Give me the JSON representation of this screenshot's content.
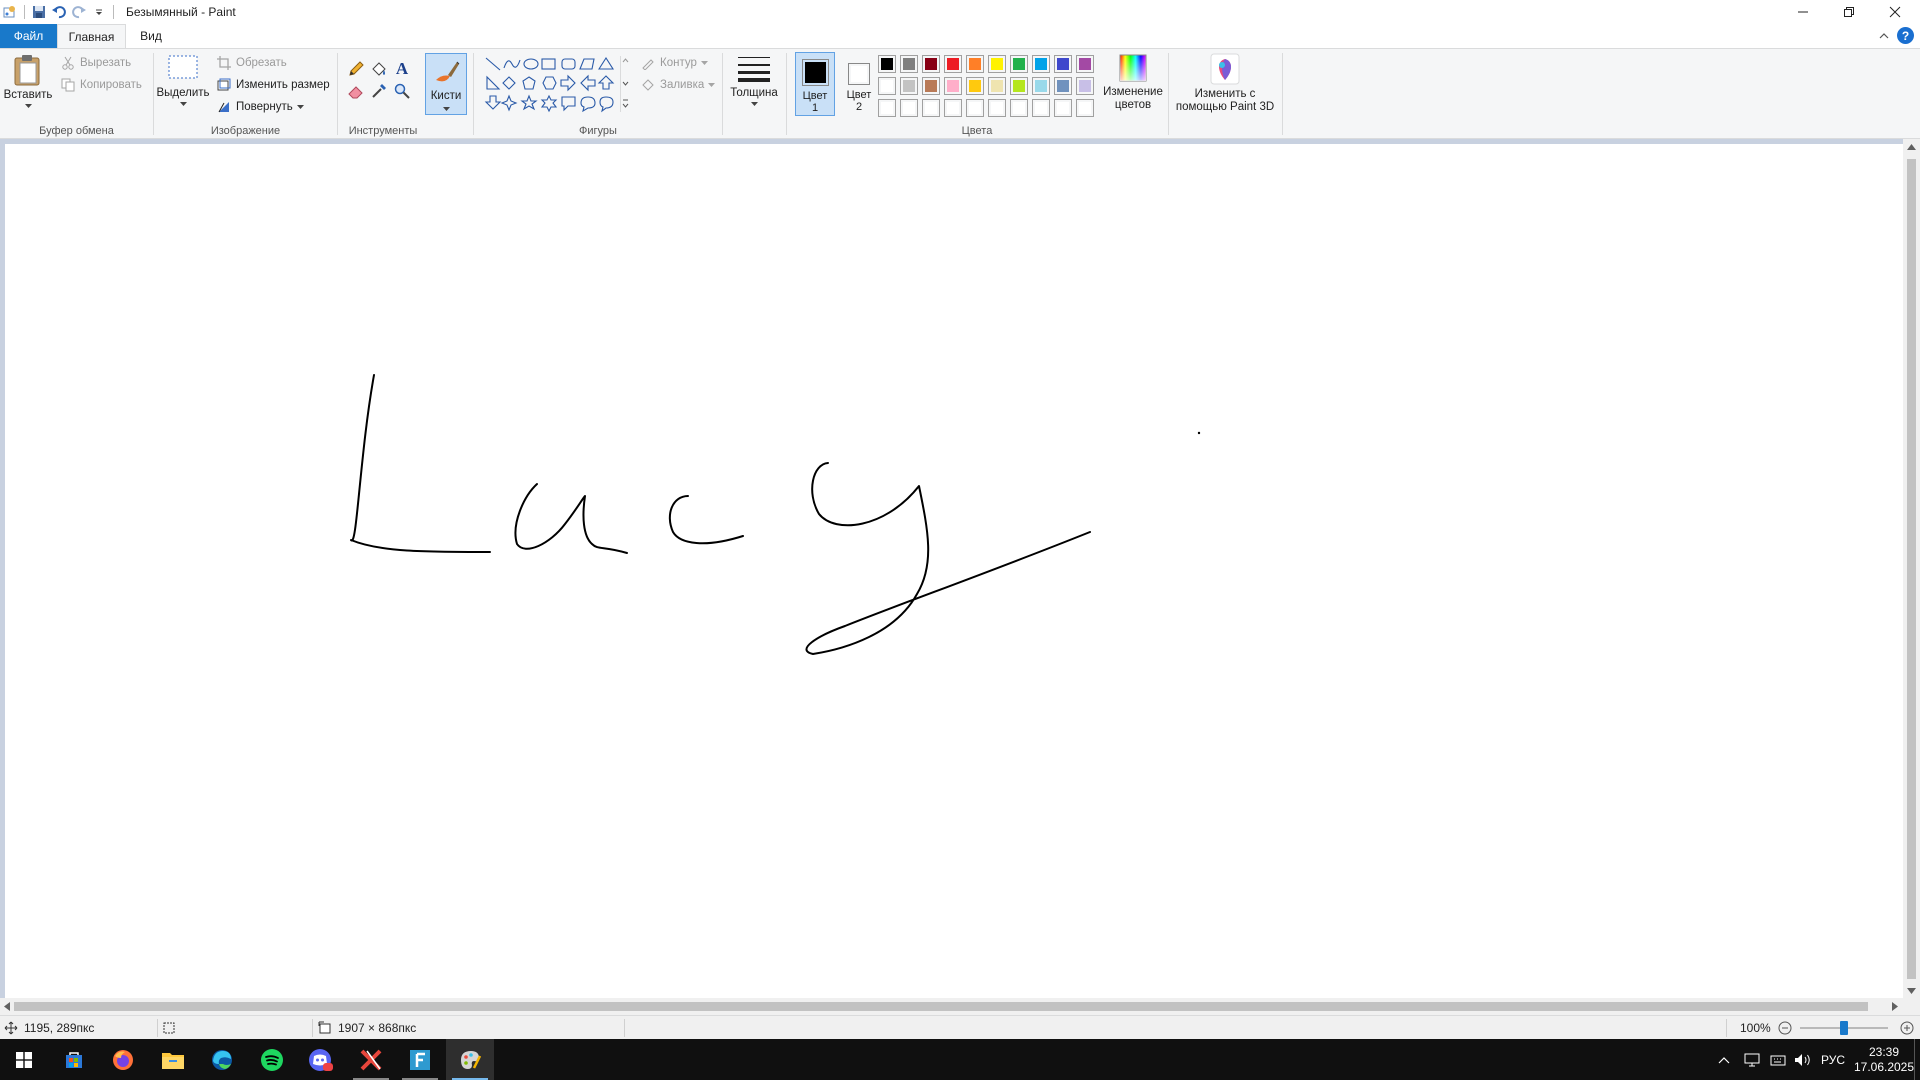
{
  "window": {
    "title": "Безымянный - Paint"
  },
  "tabs": {
    "file": "Файл",
    "home": "Главная",
    "view": "Вид"
  },
  "clipboard": {
    "paste": "Вставить",
    "cut": "Вырезать",
    "copy": "Копировать",
    "group": "Буфер обмена"
  },
  "image": {
    "select": "Выделить",
    "crop": "Обрезать",
    "resize": "Изменить размер",
    "rotate": "Повернуть",
    "group": "Изображение"
  },
  "tools": {
    "group": "Инструменты",
    "brushes": "Кисти"
  },
  "shapes": {
    "outline": "Контур",
    "fill": "Заливка",
    "group": "Фигуры"
  },
  "size": {
    "label": "Толщина"
  },
  "colors": {
    "color1_a": "Цвет",
    "color1_b": "1",
    "color2_a": "Цвет",
    "color2_b": "2",
    "edit_a": "Изменение",
    "edit_b": "цветов",
    "group": "Цвета",
    "color1_value": "#000000",
    "color2_value": "#ffffff",
    "palette_row1": [
      "#000000",
      "#7f7f7f",
      "#880015",
      "#ed1c24",
      "#ff7f27",
      "#fff200",
      "#22b14c",
      "#00a2e8",
      "#3f48cc",
      "#a349a4"
    ],
    "palette_row2": [
      "#ffffff",
      "#c3c3c3",
      "#b97a57",
      "#ffaec9",
      "#ffc90e",
      "#efe4b0",
      "#b5e61d",
      "#99d9ea",
      "#7092be",
      "#c8bfe7"
    ]
  },
  "paint3d": {
    "line1": "Изменить с",
    "line2": "помощью Paint 3D"
  },
  "statusbar": {
    "cursor_pos": "1195, 289пкс",
    "canvas_size": "1907 × 868пкс",
    "zoom": "100%",
    "zoom_fraction": 0.5
  },
  "tray": {
    "lang": "РУС",
    "time": "23:39",
    "date": "17.06.2025"
  },
  "taskbar_apps": [
    "start-icon",
    "store-icon",
    "firefox-icon",
    "file-explorer-icon",
    "edge-icon",
    "spotify-icon",
    "discord-icon",
    "x-app-icon",
    "f-app-icon",
    "paint-icon"
  ]
}
